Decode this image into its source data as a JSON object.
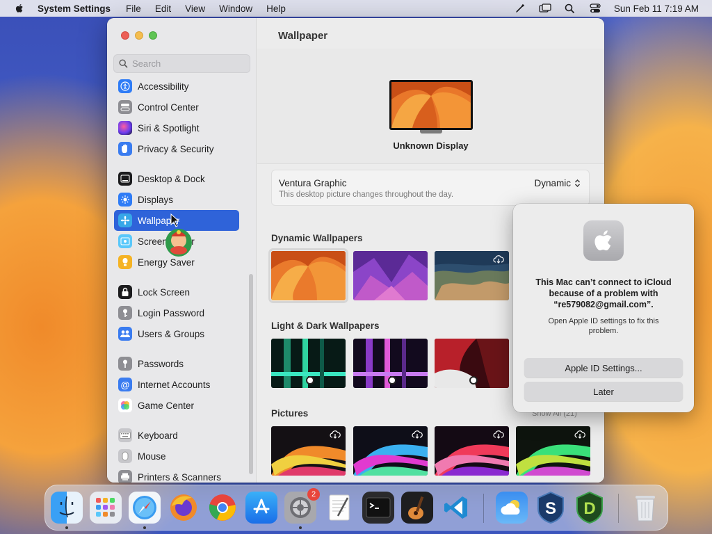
{
  "menubar": {
    "app_name": "System Settings",
    "menus": [
      "File",
      "Edit",
      "View",
      "Window",
      "Help"
    ],
    "datetime": "Sun Feb 11  7:19 AM"
  },
  "sidebar": {
    "search_placeholder": "Search",
    "items": [
      {
        "label": "Accessibility",
        "icon": "accessibility-icon",
        "color": "#2f7cf6"
      },
      {
        "label": "Control Center",
        "icon": "control-center-icon",
        "color": "#8e8e93"
      },
      {
        "label": "Siri & Spotlight",
        "icon": "siri-icon",
        "color": "#5b3fbf"
      },
      {
        "label": "Privacy & Security",
        "icon": "hand-icon",
        "color": "#3a7cf0"
      },
      {
        "label": "Desktop & Dock",
        "icon": "dock-icon",
        "color": "#1c1c1e"
      },
      {
        "label": "Displays",
        "icon": "displays-icon",
        "color": "#2f7cf6"
      },
      {
        "label": "Wallpaper",
        "icon": "wallpaper-icon",
        "color": "#37a7e8"
      },
      {
        "label": "Screen Saver",
        "icon": "screen-saver-icon",
        "color": "#5ac8fa"
      },
      {
        "label": "Energy Saver",
        "icon": "energy-saver-icon",
        "color": "#f5b324"
      },
      {
        "label": "Lock Screen",
        "icon": "lock-icon",
        "color": "#1c1c1e"
      },
      {
        "label": "Login Password",
        "icon": "key-icon",
        "color": "#8e8e93"
      },
      {
        "label": "Users & Groups",
        "icon": "users-icon",
        "color": "#3a7cf0"
      },
      {
        "label": "Passwords",
        "icon": "passwords-icon",
        "color": "#8e8e93"
      },
      {
        "label": "Internet Accounts",
        "icon": "at-icon",
        "color": "#3a7cf0"
      },
      {
        "label": "Game Center",
        "icon": "game-center-icon",
        "color": "#ffffff"
      },
      {
        "label": "Keyboard",
        "icon": "keyboard-icon",
        "color": "#b8b8bc"
      },
      {
        "label": "Mouse",
        "icon": "mouse-icon",
        "color": "#b8b8bc"
      },
      {
        "label": "Printers & Scanners",
        "icon": "printer-icon",
        "color": "#8e8e93"
      }
    ],
    "selected_index": 6
  },
  "main": {
    "title": "Wallpaper",
    "display_name": "Unknown Display",
    "current": {
      "name": "Ventura Graphic",
      "description": "This desktop picture changes throughout the day.",
      "mode": "Dynamic"
    },
    "sections": [
      {
        "title": "Dynamic Wallpapers"
      },
      {
        "title": "Light & Dark Wallpapers"
      },
      {
        "title": "Pictures",
        "show_all": "Show All (21)"
      }
    ]
  },
  "alert": {
    "title": "This Mac can’t connect to iCloud because of a problem with “re579082@gmail.com”.",
    "message": "Open Apple ID settings to fix this problem.",
    "primary_button": "Apple ID Settings...",
    "secondary_button": "Later"
  },
  "dock": {
    "apps": [
      "Finder",
      "Launchpad",
      "Safari",
      "Firefox",
      "Chrome",
      "App Store",
      "System Settings",
      "TextEdit",
      "Terminal",
      "GarageBand",
      "VS Code",
      "Weather",
      "Scrivener",
      "Dash",
      "Trash"
    ],
    "system_settings_badge": "2"
  },
  "colors": {
    "accent": "#2f63d9",
    "close": "#ec5f57",
    "minimize": "#f4bd4f",
    "maximize": "#5fc454"
  }
}
